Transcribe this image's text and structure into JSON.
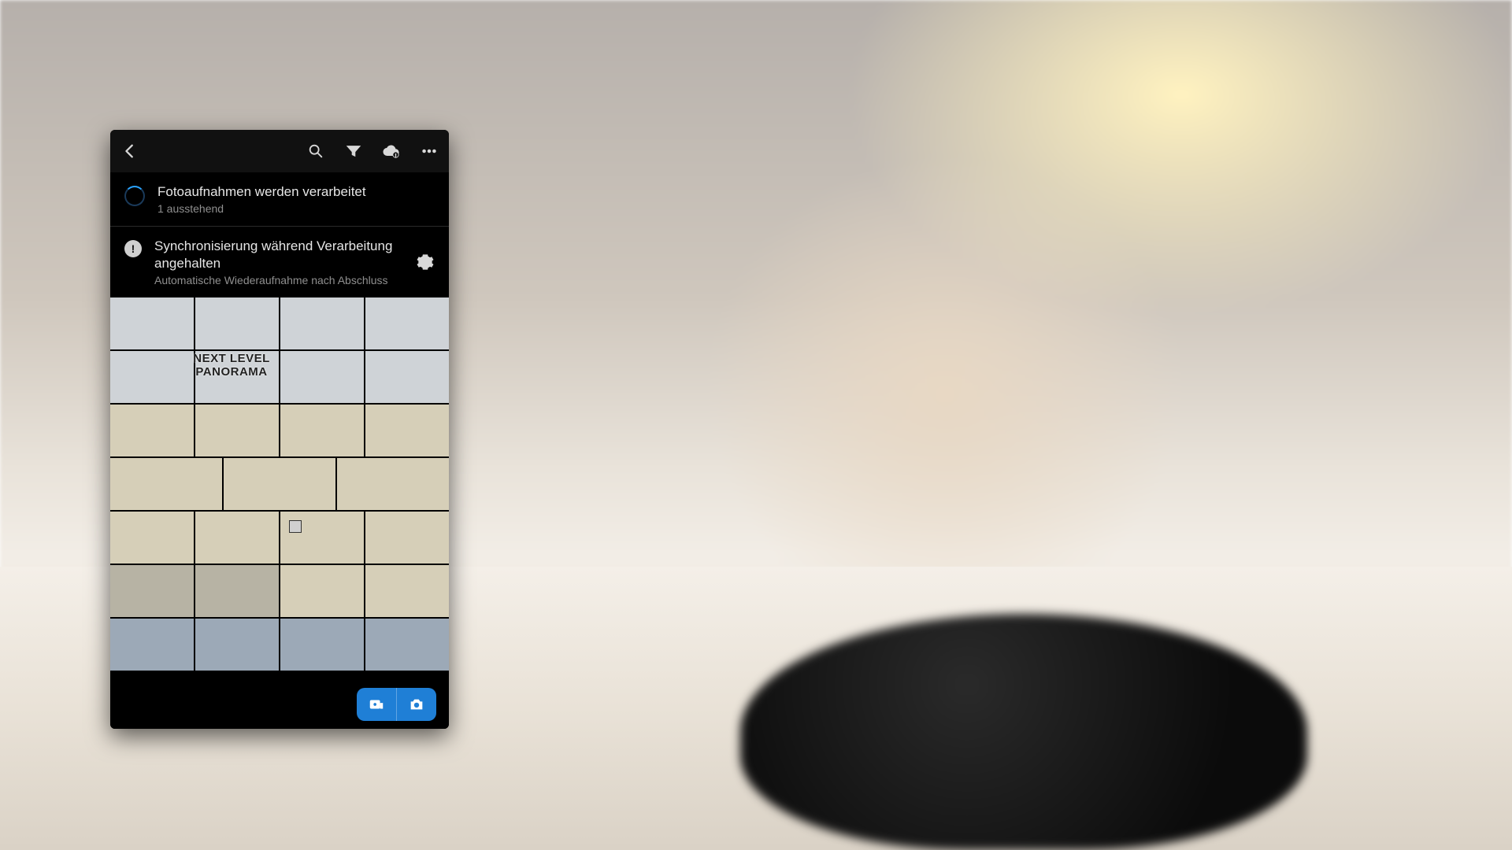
{
  "toolbar": {
    "back": "back",
    "search": "search",
    "filter": "filter",
    "cloud": "cloud sync",
    "more": "more"
  },
  "status_processing": {
    "title": "Fotoaufnahmen werden verarbeitet",
    "subtitle": "1 ausstehend"
  },
  "status_sync": {
    "title": "Synchronisierung während Verarbeitung angehalten",
    "subtitle": "Automatische Wiederaufnahme nach Abschluss"
  },
  "thumb_overlay": "NEXT LEVEL PANORAMA",
  "fab": {
    "import": "import",
    "camera": "camera"
  },
  "accent": "#1f7fd6"
}
